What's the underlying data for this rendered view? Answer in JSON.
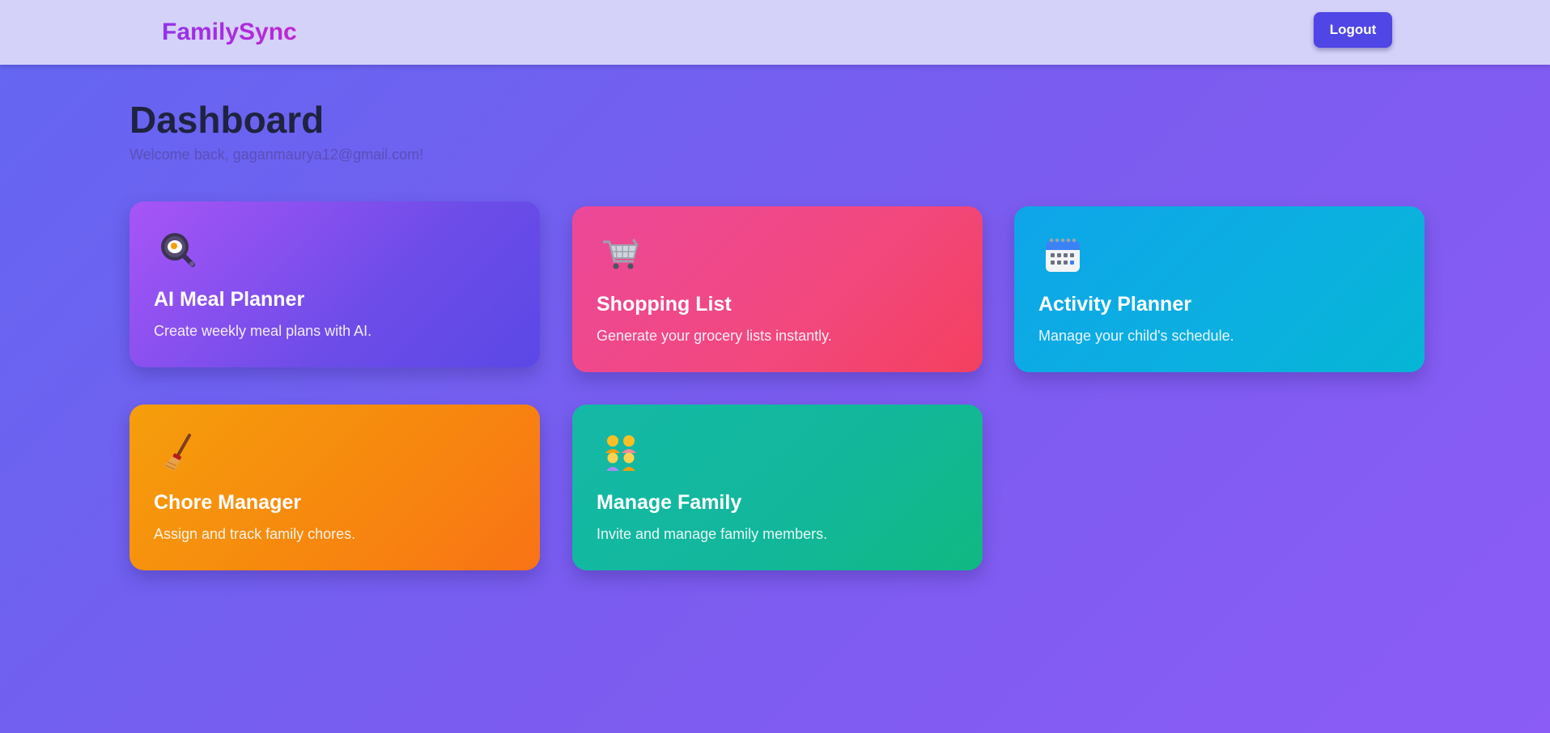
{
  "app": {
    "brand": "FamilySync"
  },
  "header": {
    "logout_label": "Logout"
  },
  "dashboard": {
    "title": "Dashboard",
    "welcome": "Welcome back, gaganmaurya12@gmail.com!"
  },
  "cards": [
    {
      "icon": "frying-pan-icon",
      "title": "AI Meal Planner",
      "description": "Create weekly meal plans with AI.",
      "color": "#8b5cf6"
    },
    {
      "icon": "shopping-cart-icon",
      "title": "Shopping List",
      "description": "Generate your grocery lists instantly.",
      "color": "#ec4899"
    },
    {
      "icon": "calendar-icon",
      "title": "Activity Planner",
      "description": "Manage your child's schedule.",
      "color": "#0ea5e9"
    },
    {
      "icon": "broom-icon",
      "title": "Chore Manager",
      "description": "Assign and track family chores.",
      "color": "#f59e0b"
    },
    {
      "icon": "family-icon",
      "title": "Manage Family",
      "description": "Invite and manage family members.",
      "color": "#14b8a6"
    }
  ]
}
